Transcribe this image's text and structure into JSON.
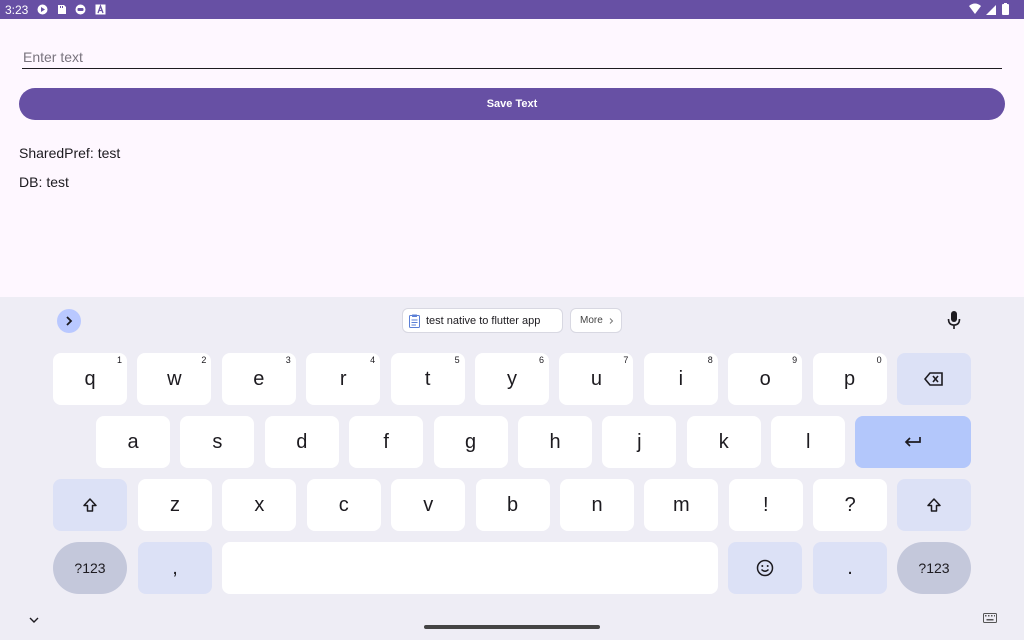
{
  "status_bar": {
    "time": "3:23",
    "left_icons": [
      "play-protect-icon",
      "sd-card-icon",
      "robot-icon",
      "font-icon"
    ],
    "right_icons": [
      "wifi-icon",
      "signal-icon",
      "battery-icon"
    ]
  },
  "form": {
    "input_placeholder": "Enter text",
    "input_value": "",
    "save_label": "Save Text"
  },
  "results": {
    "sharedpref_label": "SharedPref:",
    "sharedpref_value": "test",
    "db_label": "DB:",
    "db_value": "test"
  },
  "keyboard": {
    "suggestion_clip": "test native to flutter app",
    "suggestion_more": "More",
    "row1": [
      {
        "char": "q",
        "hint": "1"
      },
      {
        "char": "w",
        "hint": "2"
      },
      {
        "char": "e",
        "hint": "3"
      },
      {
        "char": "r",
        "hint": "4"
      },
      {
        "char": "t",
        "hint": "5"
      },
      {
        "char": "y",
        "hint": "6"
      },
      {
        "char": "u",
        "hint": "7"
      },
      {
        "char": "i",
        "hint": "8"
      },
      {
        "char": "o",
        "hint": "9"
      },
      {
        "char": "p",
        "hint": "0"
      }
    ],
    "row2": [
      "a",
      "s",
      "d",
      "f",
      "g",
      "h",
      "j",
      "k",
      "l"
    ],
    "row3": [
      "z",
      "x",
      "c",
      "v",
      "b",
      "n",
      "m",
      "!",
      "?"
    ],
    "symbols_label": "?123",
    "comma": ",",
    "period": ".",
    "colors": {
      "accent": "#6750a4",
      "key_fn": "#dce1f6",
      "enter": "#b3c7fb"
    }
  }
}
